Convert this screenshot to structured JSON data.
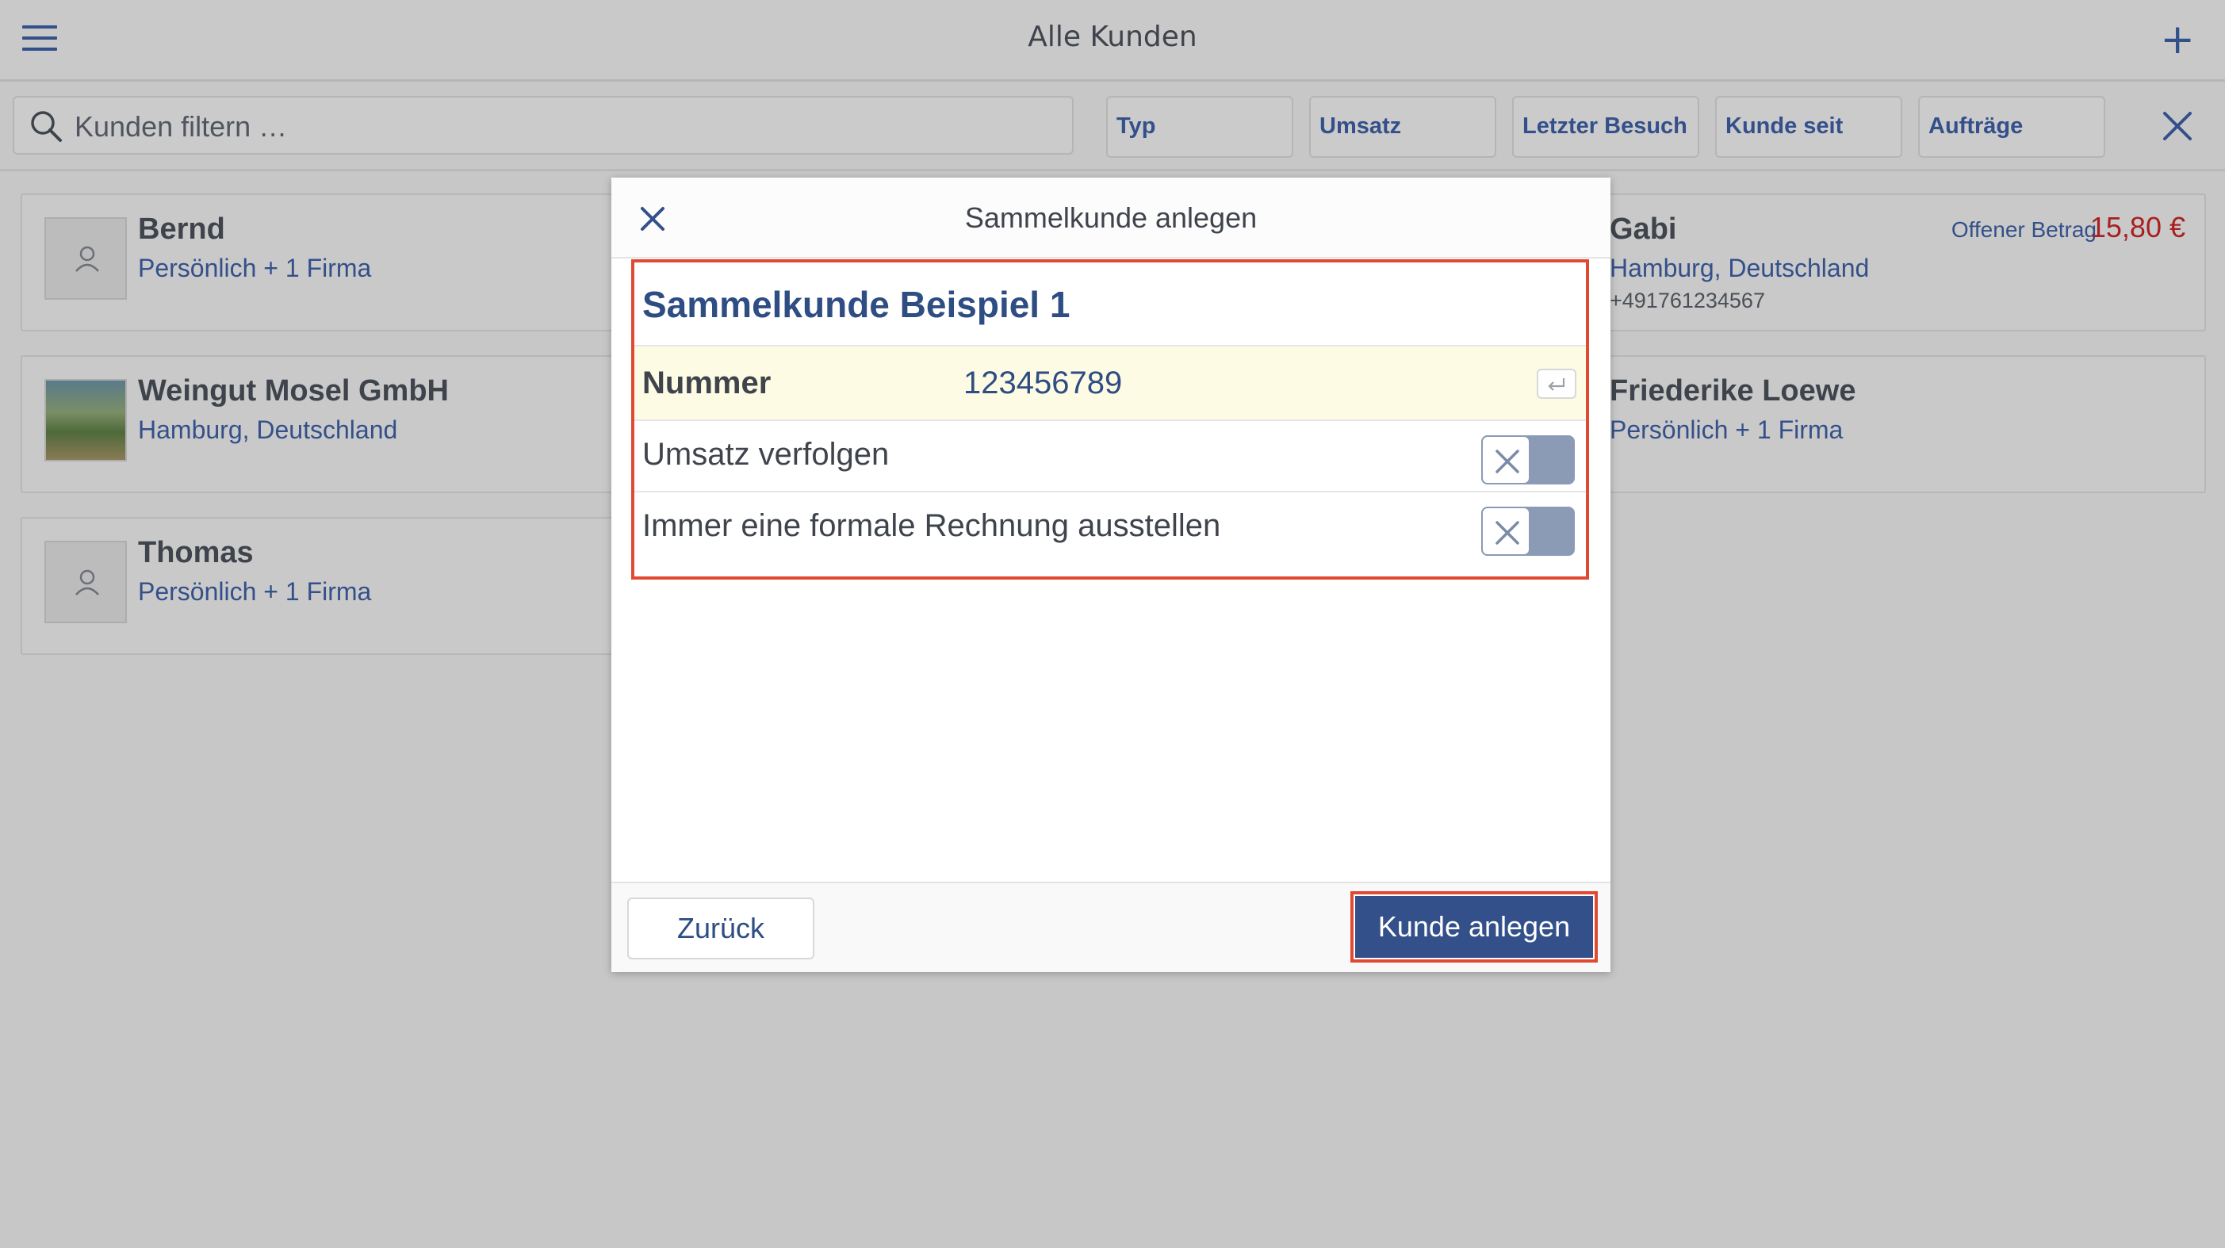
{
  "header": {
    "title": "Alle Kunden",
    "add_label": "+"
  },
  "filter": {
    "search_placeholder": "Kunden filtern …",
    "chips": [
      "Typ",
      "Umsatz",
      "Letzter Besuch",
      "Kunde seit",
      "Aufträge"
    ]
  },
  "customers_left": [
    {
      "name": "Bernd",
      "subtitle": "Persönlich + 1 Firma",
      "avatar": "person-icon"
    },
    {
      "name": "Weingut Mosel GmbH",
      "subtitle": "Hamburg, Deutschland",
      "avatar": "photo"
    },
    {
      "name": "Thomas",
      "subtitle": "Persönlich + 1 Firma",
      "avatar": "person-icon"
    }
  ],
  "customers_right": [
    {
      "name": "Gabi",
      "subtitle": "Hamburg, Deutschland",
      "phone": "+491761234567",
      "open_label": "Offener Betrag",
      "open_amount": "15,80 €"
    },
    {
      "name": "Friederike Loewe",
      "subtitle": "Persönlich + 1 Firma"
    }
  ],
  "modal": {
    "title": "Sammelkunde anlegen",
    "group_name": "Sammelkunde Beispiel 1",
    "number_label": "Nummer",
    "number_value": "123456789",
    "track_sales_label": "Umsatz verfolgen",
    "track_sales_on": false,
    "formal_invoice_label": "Immer eine formale Rechnung ausstellen",
    "formal_invoice_on": false,
    "back_label": "Zurück",
    "create_label": "Kunde anlegen"
  },
  "colors": {
    "accent": "#34508a",
    "highlight": "#e04a33",
    "amount": "#a82020"
  }
}
